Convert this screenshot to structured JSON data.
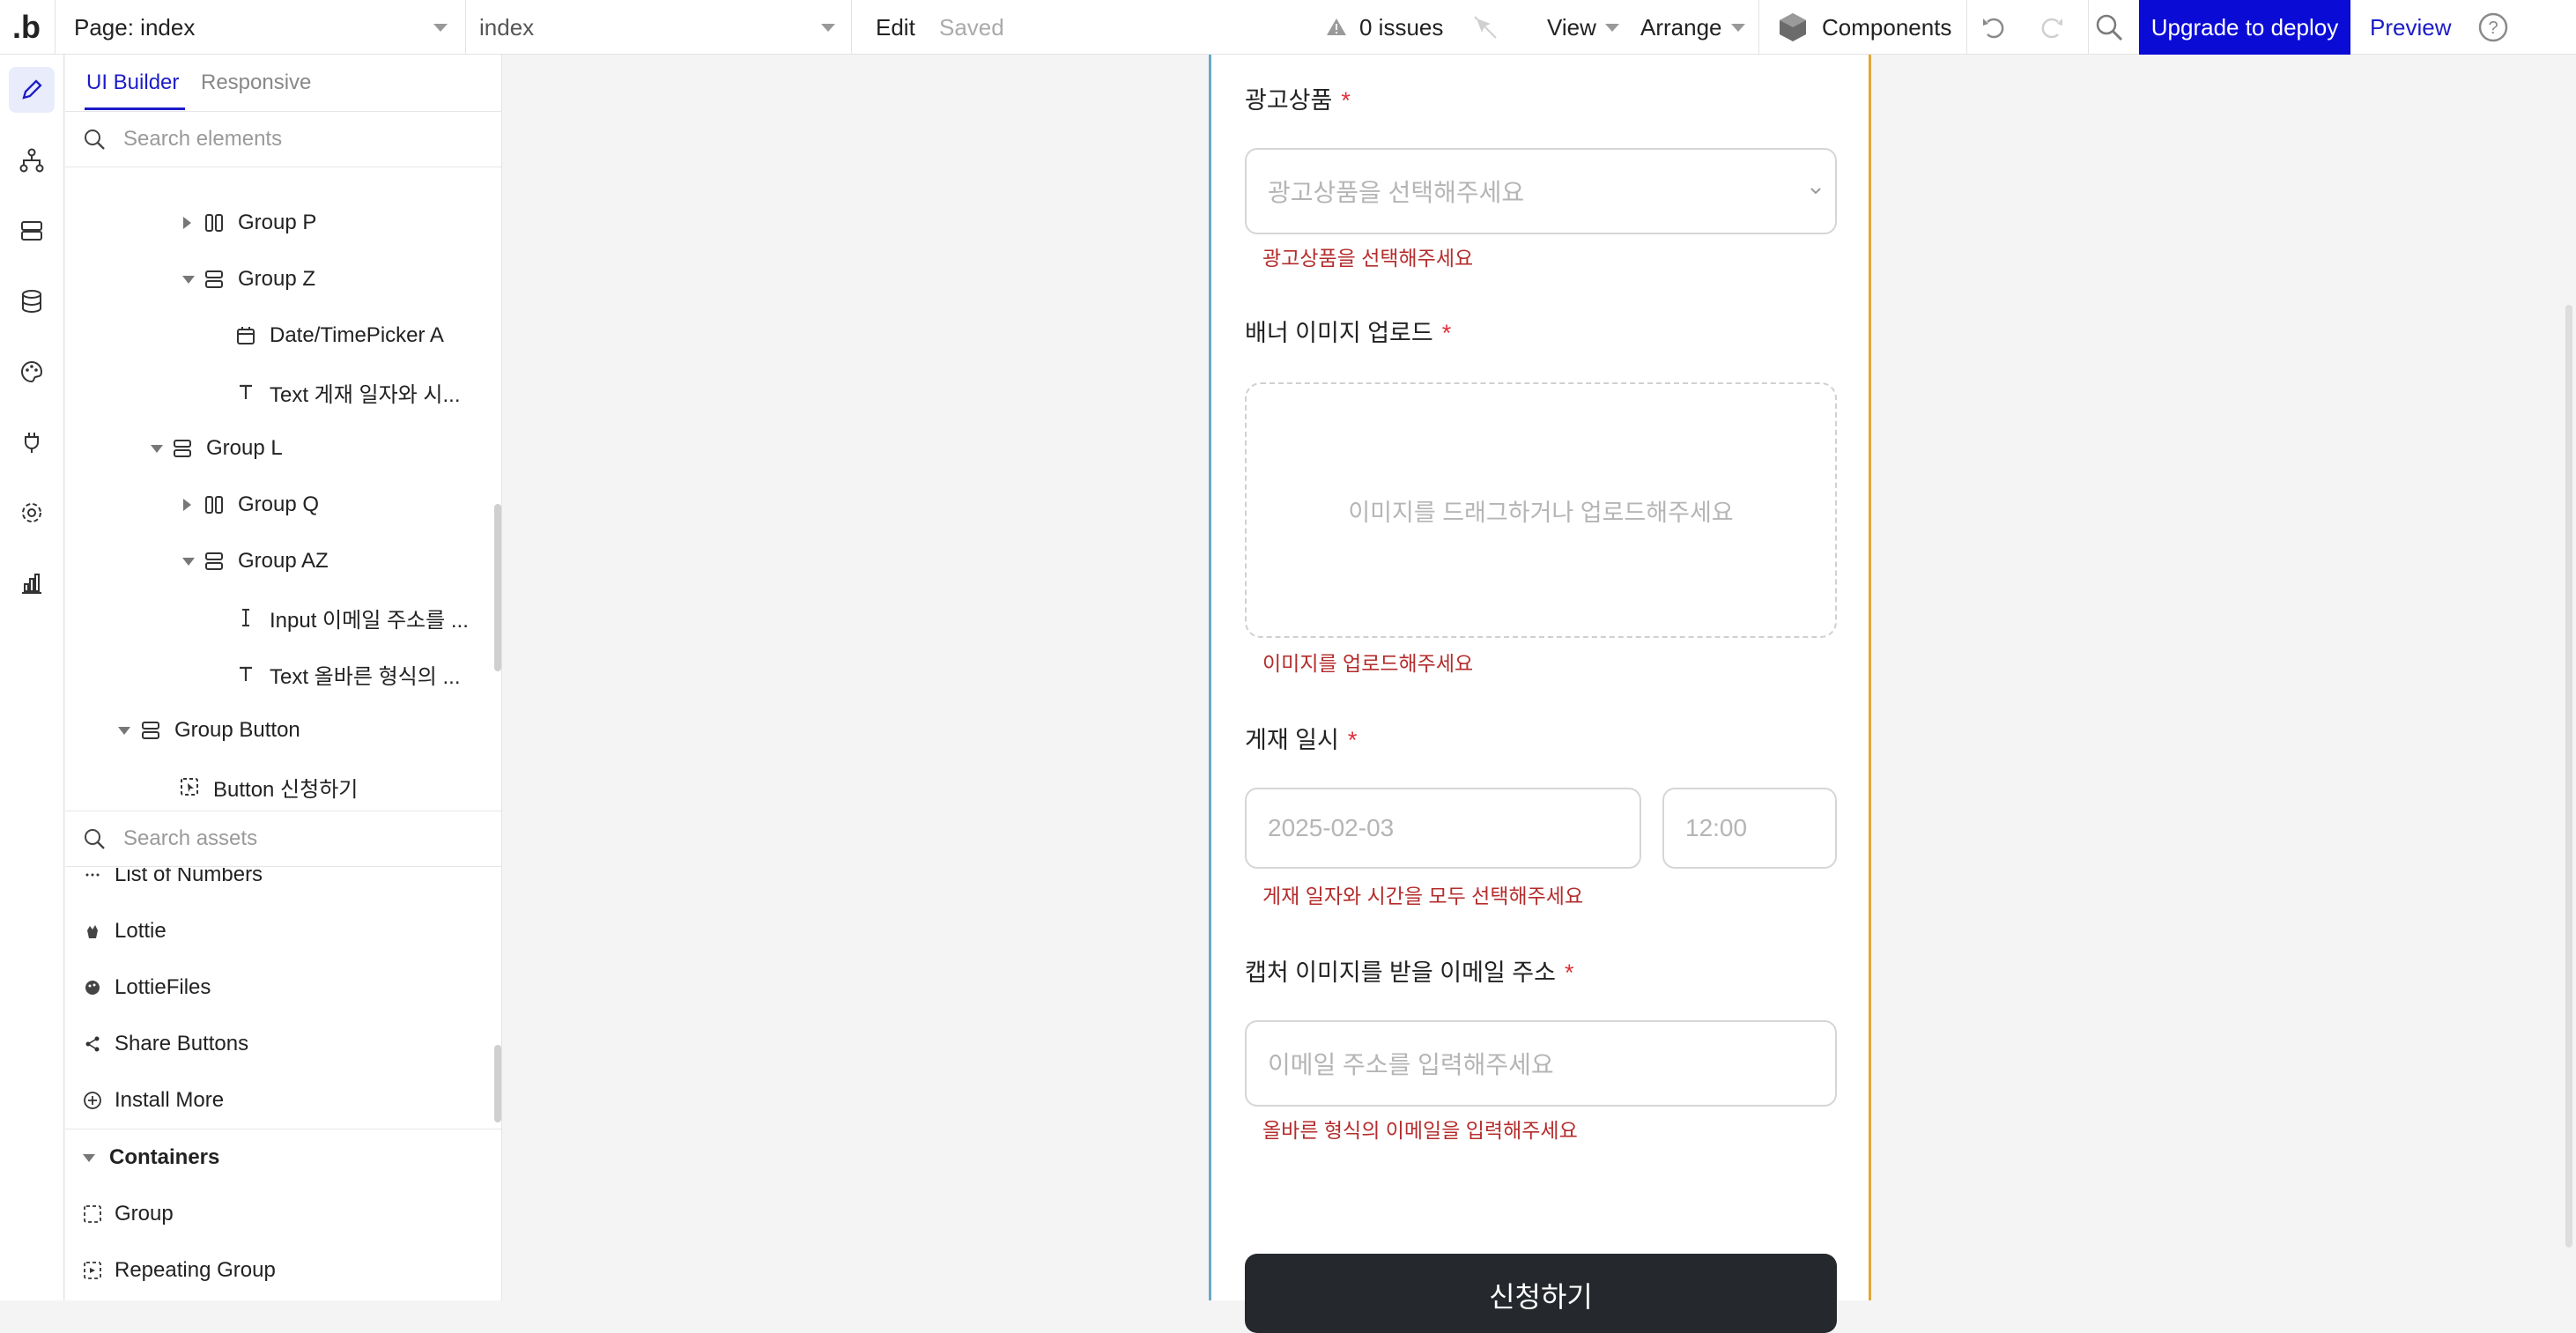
{
  "topbar": {
    "logo": ".b",
    "page_selector": "Page: index",
    "element_selector": "index",
    "edit": "Edit",
    "saved": "Saved",
    "issues": "0 issues",
    "view": "View",
    "arrange": "Arrange",
    "components": "Components",
    "upgrade": "Upgrade to deploy",
    "preview": "Preview"
  },
  "panel": {
    "tabs": [
      "UI Builder",
      "Responsive"
    ],
    "search_elements_placeholder": "Search elements",
    "tree": [
      {
        "label": "Group P",
        "kind": "row-group",
        "caret": "right"
      },
      {
        "label": "Group Z",
        "kind": "col-group",
        "caret": "down"
      },
      {
        "label": "Date/TimePicker A",
        "kind": "date"
      },
      {
        "label": "Text 게재 일자와 시...",
        "kind": "text"
      },
      {
        "label": "Group L",
        "kind": "col-group",
        "caret": "down"
      },
      {
        "label": "Group Q",
        "kind": "row-group",
        "caret": "right"
      },
      {
        "label": "Group AZ",
        "kind": "col-group",
        "caret": "down"
      },
      {
        "label": "Input 이메일 주소를 ...",
        "kind": "input"
      },
      {
        "label": "Text 올바른 형식의 ...",
        "kind": "text"
      },
      {
        "label": "Group Button",
        "kind": "col-group",
        "caret": "down"
      },
      {
        "label": "Button 신청하기",
        "kind": "button"
      }
    ],
    "search_assets_placeholder": "Search assets",
    "assets": [
      {
        "label": "List of Numbers",
        "icon": "dots-icon"
      },
      {
        "label": "Lottie",
        "icon": "lottie-icon"
      },
      {
        "label": "LottieFiles",
        "icon": "lottiefiles-icon"
      },
      {
        "label": "Share Buttons",
        "icon": "share-icon"
      },
      {
        "label": "Install More",
        "icon": "plus-circle-icon"
      }
    ],
    "containers_header": "Containers",
    "containers": [
      {
        "label": "Group",
        "icon": "group-icon"
      },
      {
        "label": "Repeating Group",
        "icon": "repeating-group-icon"
      }
    ]
  },
  "form": {
    "product_label": "광고상품",
    "product_placeholder": "광고상품을 선택해주세요",
    "product_error": "광고상품을 선택해주세요",
    "banner_label": "배너 이미지 업로드",
    "banner_drop_text": "이미지를 드래그하거나 업로드해주세요",
    "banner_error": "이미지를 업로드해주세요",
    "date_label": "게재 일시",
    "date_value": "2025-02-03",
    "time_value": "12:00",
    "date_error": "게재 일자와 시간을 모두 선택해주세요",
    "email_label": "캡처 이미지를 받을 이메일 주소",
    "email_placeholder": "이메일 주소를 입력해주세요",
    "email_error": "올바른 형식의 이메일을 입력해주세요",
    "required_mark": "*",
    "submit": "신청하기"
  },
  "colors": {
    "accent": "#0b0bd6",
    "error": "#b52c2c",
    "required": "#e0303a",
    "button": "#25282c"
  }
}
